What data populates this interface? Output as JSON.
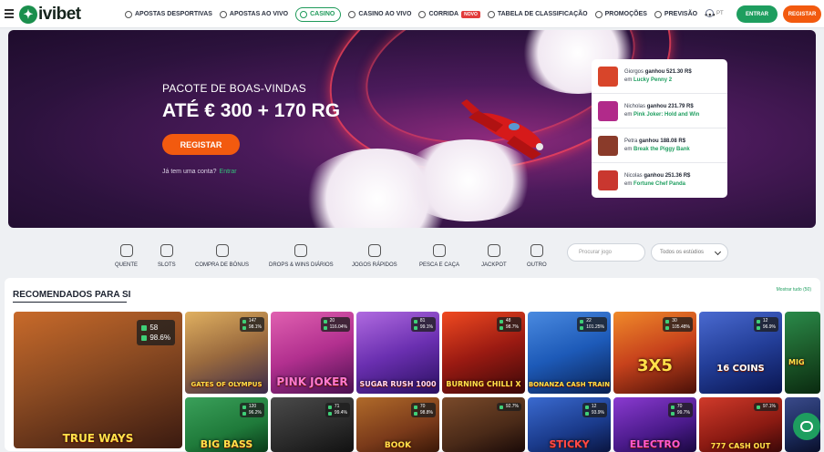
{
  "header": {
    "logo_text": "ivibet",
    "nav": [
      {
        "label": "APOSTAS DESPORTIVAS",
        "icon": "soccer-ball-icon"
      },
      {
        "label": "APOSTAS AO VIVO",
        "icon": "live-icon"
      },
      {
        "label": "CASINO",
        "icon": "casino-chip-icon",
        "active": true
      },
      {
        "label": "CASINO AO VIVO",
        "icon": "cards-icon"
      },
      {
        "label": "CORRIDA",
        "icon": "horse-icon",
        "badge": "NOVO"
      },
      {
        "label": "TABELA DE CLASSIFICAÇÃO",
        "icon": "ranking-icon"
      },
      {
        "label": "PROMOÇÕES",
        "icon": "gift-icon"
      },
      {
        "label": "PREVISÃO",
        "icon": "forecast-icon"
      }
    ],
    "more": "•••",
    "lang": "PT",
    "login_label": "ENTRAR",
    "register_label": "REGISTAR"
  },
  "hero": {
    "subtitle": "PACOTE DE BOAS-VINDAS",
    "title": "ATÉ € 300 + 170 RG",
    "button": "REGISTAR",
    "account_text": "Já tem uma conta?",
    "account_link": "Entrar"
  },
  "winners": [
    {
      "name": "Giorgos",
      "verb": "ganhou",
      "amount": "521.30 R$",
      "prefix": "em",
      "game": "Lucky Penny 2",
      "color": "#d8452a"
    },
    {
      "name": "Nicholas",
      "verb": "ganhou",
      "amount": "231.79 R$",
      "prefix": "em",
      "game": "Pink Joker: Hold and Win",
      "color": "#b12a8a"
    },
    {
      "name": "Petra",
      "verb": "ganhou",
      "amount": "188.08 R$",
      "prefix": "em",
      "game": "Break the Piggy Bank",
      "color": "#8a3b2a"
    },
    {
      "name": "Nicolas",
      "verb": "ganhou",
      "amount": "251.36 R$",
      "prefix": "em",
      "game": "Fortune Chef Panda",
      "color": "#c9372f"
    }
  ],
  "categories": [
    {
      "label": "QUENTE",
      "icon": "chili-icon"
    },
    {
      "label": "SLOTS",
      "icon": "cherries-icon"
    },
    {
      "label": "COMPRA DE BÓNUS",
      "icon": "money-bag-icon"
    },
    {
      "label": "DROPS & WINS DIÁRIOS",
      "icon": "cake-icon"
    },
    {
      "label": "JOGOS RÁPIDOS",
      "icon": "lightning-icon"
    },
    {
      "label": "PESCA E CAÇA",
      "icon": "target-icon"
    },
    {
      "label": "JACKPOT",
      "icon": "jackpot-icon"
    },
    {
      "label": "OUTRO",
      "icon": "medal-icon"
    }
  ],
  "search": {
    "placeholder": "Procurar jogo"
  },
  "studio_select": {
    "value": "Todos os estúdios"
  },
  "section": {
    "title": "RECOMENDADOS PARA SI",
    "show_all": "Mostrar tudo (50)"
  },
  "games_row1": [
    {
      "name": "TRUE WAYS",
      "players": "58",
      "rtp": "98.6%",
      "color": "#8a4a22"
    },
    {
      "name": "GATES OF OLYMPUS",
      "players": "147",
      "rtp": "98.1%",
      "color": "#9a6a3e"
    },
    {
      "name": "PINK JOKER",
      "players": "20",
      "rtp": "116.04%",
      "color": "#b2308f"
    },
    {
      "name": "SUGAR RUSH 1000",
      "players": "81",
      "rtp": "99.1%",
      "color": "#6a2fb0"
    },
    {
      "name": "BURNING CHILLI X",
      "players": "48",
      "rtp": "98.7%",
      "color": "#9a1a12"
    },
    {
      "name": "BONANZA CASH TRAIN",
      "players": "22",
      "rtp": "101.25%",
      "color": "#1d5ab8"
    },
    {
      "name": "3X5",
      "players": "30",
      "rtp": "105.48%",
      "color": "#c7421c"
    },
    {
      "name": "16 COINS",
      "players": "12",
      "rtp": "96.9%",
      "color": "#233e98"
    },
    {
      "name": "MIG",
      "players": "",
      "rtp": "",
      "color": "#1c5a2a"
    }
  ],
  "games_row2": [
    {
      "name": "BIG BASS",
      "players": "120",
      "rtp": "96.2%",
      "color": "#1f7a3a"
    },
    {
      "name": "",
      "players": "71",
      "rtp": "99.4%",
      "color": "#2a2a2a"
    },
    {
      "name": "BOOK",
      "players": "70",
      "rtp": "98.8%",
      "color": "#7a3a1a"
    },
    {
      "name": "",
      "players": "",
      "rtp": "92.7%",
      "color": "#4a2a18"
    },
    {
      "name": "STICKY",
      "players": "12",
      "rtp": "93.9%",
      "color": "#1a3a8a"
    },
    {
      "name": "ELECTRO",
      "players": "70",
      "rtp": "99.7%",
      "color": "#4a1a8a"
    },
    {
      "name": "777 CASH OUT",
      "players": "",
      "rtp": "97.1%",
      "color": "#8a1a12"
    },
    {
      "name": "",
      "players": "",
      "rtp": "",
      "color": "#1a2a5a"
    }
  ]
}
